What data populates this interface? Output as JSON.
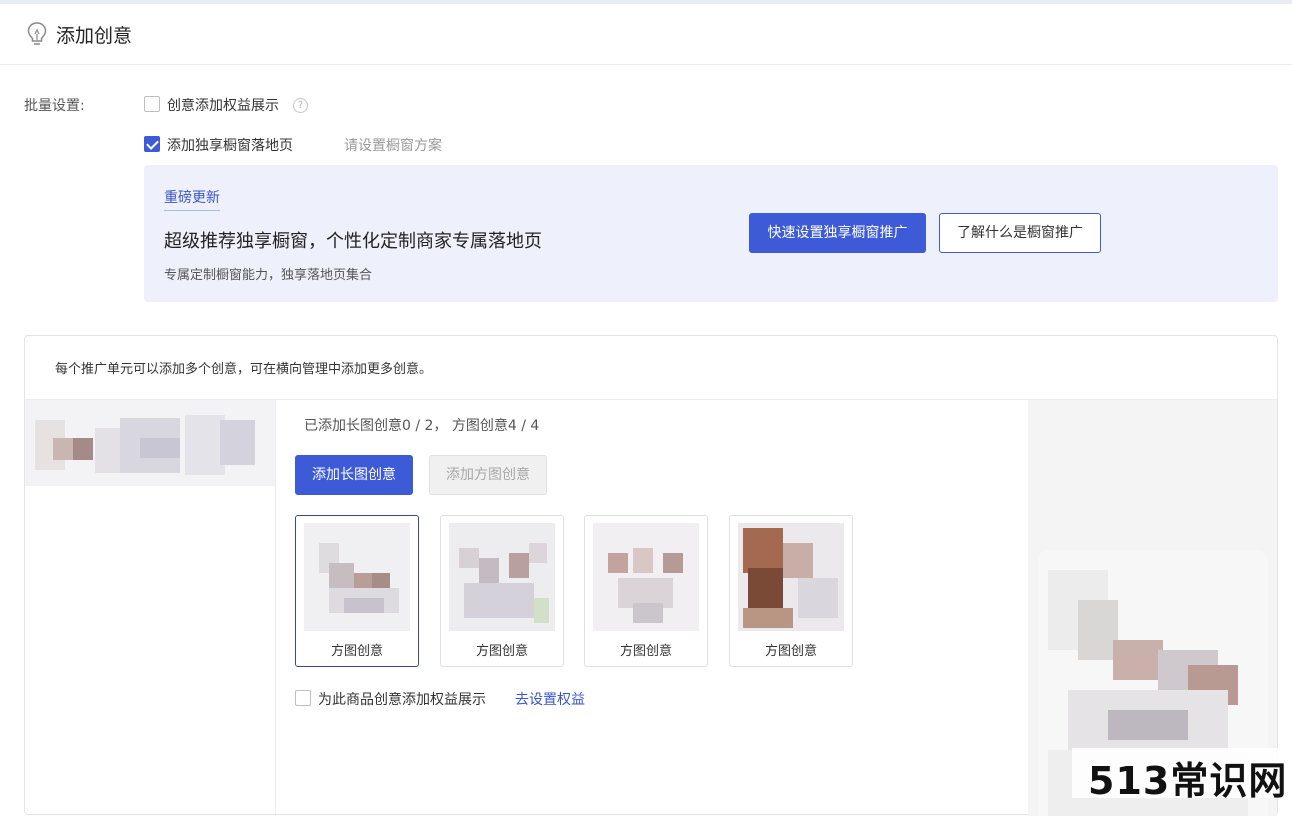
{
  "header": {
    "title": "添加创意",
    "icon": "bulb-icon"
  },
  "batch": {
    "label": "批量设置:",
    "option1": {
      "label": "创意添加权益展示",
      "checked": false
    },
    "option2": {
      "label": "添加独享橱窗落地页",
      "checked": true,
      "hint": "请设置橱窗方案"
    }
  },
  "promo": {
    "tag": "重磅更新",
    "headline": "超级推荐独享橱窗，个性化定制商家专属落地页",
    "sub": "专属定制橱窗能力，独享落地页集合",
    "primary_button": "快速设置独享橱窗推广",
    "secondary_button": "了解什么是橱窗推广",
    "accent": "#3d5bd6"
  },
  "panel": {
    "note": "每个推广单元可以添加多个创意，可在横向管理中添加更多创意。",
    "count_text": "已添加长图创意0 / 2， 方图创意4 / 4",
    "add_long_button": "添加长图创意",
    "add_square_button": "添加方图创意",
    "cards": [
      {
        "label": "方图创意",
        "active": true
      },
      {
        "label": "方图创意",
        "active": false
      },
      {
        "label": "方图创意",
        "active": false
      },
      {
        "label": "方图创意",
        "active": false
      }
    ],
    "benefit_checkbox": {
      "label": "为此商品创意添加权益展示",
      "checked": false
    },
    "benefit_link": "去设置权益"
  },
  "watermark": "513常识网"
}
